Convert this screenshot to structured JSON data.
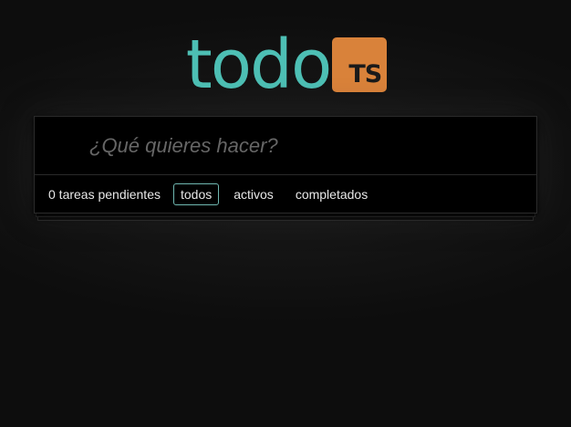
{
  "header": {
    "logo_text": "todo",
    "logo_badge": "TS"
  },
  "new_todo": {
    "placeholder": "¿Qué quieres hacer?",
    "value": ""
  },
  "footer": {
    "count_text": "0 tareas pendientes",
    "filters": [
      {
        "label": "todos",
        "selected": true
      },
      {
        "label": "activos",
        "selected": false
      },
      {
        "label": "completados",
        "selected": false
      }
    ]
  },
  "colors": {
    "logo_teal": "#4dbfb4",
    "badge_orange": "#d9823a",
    "selected_border": "#6fb8b1",
    "background": "#0d0d0d"
  }
}
